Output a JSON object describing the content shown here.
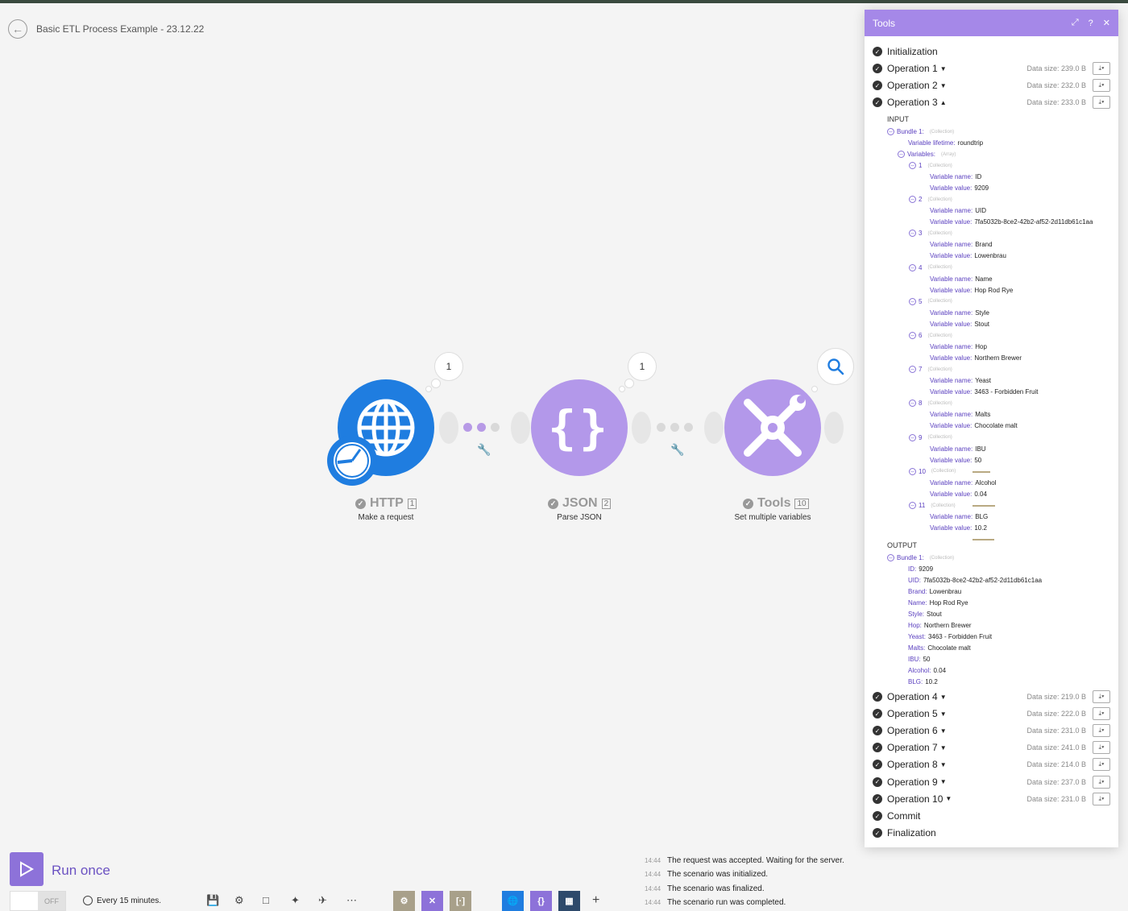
{
  "scenario": {
    "title": "Basic ETL Process Example - 23.12.22"
  },
  "colors": {
    "http": "#1f7de0",
    "json": "#b398ea",
    "tools": "#b398ea",
    "panel_header": "#a588e8",
    "accent": "#6b52c2"
  },
  "modules": [
    {
      "name": "HTTP",
      "num": "1",
      "subtitle": "Make a request",
      "bubble": "1",
      "icon": "globe-icon"
    },
    {
      "name": "JSON",
      "num": "2",
      "subtitle": "Parse JSON",
      "bubble": "1",
      "icon": "braces-icon"
    },
    {
      "name": "Tools",
      "num": "10",
      "subtitle": "Set multiple variables",
      "icon": "tools-icon"
    }
  ],
  "panel": {
    "title": "Tools",
    "header_icons": [
      "expand-icon",
      "help-icon",
      "close-icon"
    ],
    "initialization": "Initialization",
    "operations_top": [
      {
        "label": "Operation 1",
        "data_size": "Data size: 239.0 B"
      },
      {
        "label": "Operation 2",
        "data_size": "Data size: 232.0 B"
      },
      {
        "label": "Operation 3",
        "data_size": "Data size: 233.0 B"
      }
    ],
    "input_label": "INPUT",
    "output_label": "OUTPUT",
    "bundle": "Bundle 1:",
    "collection": "(Collection)",
    "array": "(Array)",
    "lifetime_key": "Variable lifetime:",
    "lifetime_value": "roundtrip",
    "variables_key": "Variables:",
    "vname_key": "Variable name:",
    "vvalue_key": "Variable value:",
    "variables": [
      {
        "idx": "1",
        "name": "ID",
        "value": "9209"
      },
      {
        "idx": "2",
        "name": "UID",
        "value": "7fa5032b-8ce2-42b2-af52-2d11db61c1aa"
      },
      {
        "idx": "3",
        "name": "Brand",
        "value": "Lowenbrau"
      },
      {
        "idx": "4",
        "name": "Name",
        "value": "Hop Rod Rye"
      },
      {
        "idx": "5",
        "name": "Style",
        "value": "Stout"
      },
      {
        "idx": "6",
        "name": "Hop",
        "value": "Northern Brewer"
      },
      {
        "idx": "7",
        "name": "Yeast",
        "value": "3463 - Forbidden Fruit"
      },
      {
        "idx": "8",
        "name": "Malts",
        "value": "Chocolate malt"
      },
      {
        "idx": "9",
        "name": "IBU",
        "value": "50"
      },
      {
        "idx": "10",
        "name": "Alcohol",
        "value": "0.04"
      },
      {
        "idx": "11",
        "name": "BLG",
        "value": "10.2"
      }
    ],
    "output": [
      {
        "key": "ID:",
        "value": "9209"
      },
      {
        "key": "UID:",
        "value": "7fa5032b-8ce2-42b2-af52-2d11db61c1aa"
      },
      {
        "key": "Brand:",
        "value": "Lowenbrau"
      },
      {
        "key": "Name:",
        "value": "Hop Rod Rye"
      },
      {
        "key": "Style:",
        "value": "Stout"
      },
      {
        "key": "Hop:",
        "value": "Northern Brewer"
      },
      {
        "key": "Yeast:",
        "value": "3463 - Forbidden Fruit"
      },
      {
        "key": "Malts:",
        "value": "Chocolate malt"
      },
      {
        "key": "IBU:",
        "value": "50"
      },
      {
        "key": "Alcohol:",
        "value": "0.04"
      },
      {
        "key": "BLG:",
        "value": "10.2"
      }
    ],
    "operations_bottom": [
      {
        "label": "Operation 4",
        "data_size": "Data size: 219.0 B"
      },
      {
        "label": "Operation 5",
        "data_size": "Data size: 222.0 B"
      },
      {
        "label": "Operation 6",
        "data_size": "Data size: 231.0 B"
      },
      {
        "label": "Operation 7",
        "data_size": "Data size: 241.0 B"
      },
      {
        "label": "Operation 8",
        "data_size": "Data size: 214.0 B"
      },
      {
        "label": "Operation 9",
        "data_size": "Data size: 237.0 B"
      },
      {
        "label": "Operation 10",
        "data_size": "Data size: 231.0 B"
      }
    ],
    "commit": "Commit",
    "finalization": "Finalization"
  },
  "footer": {
    "run_label": "Run once",
    "toggle": "OFF",
    "schedule": "Every 15 minutes.",
    "toolbar_icons": [
      "save-icon",
      "settings-icon",
      "notes-icon",
      "magic-wand-icon",
      "airplane-icon",
      "more-icon"
    ],
    "favorites": [
      "tools-module",
      "flow-module",
      "text-module"
    ],
    "quick_modules": [
      "http-module",
      "json-module",
      "sheets-module",
      "add-icon"
    ]
  },
  "log": [
    {
      "time": "14:44",
      "text": "The request was accepted. Waiting for the server."
    },
    {
      "time": "14:44",
      "text": "The scenario was initialized."
    },
    {
      "time": "14:44",
      "text": "The scenario was finalized."
    },
    {
      "time": "14:44",
      "text": "The scenario run was completed."
    }
  ]
}
